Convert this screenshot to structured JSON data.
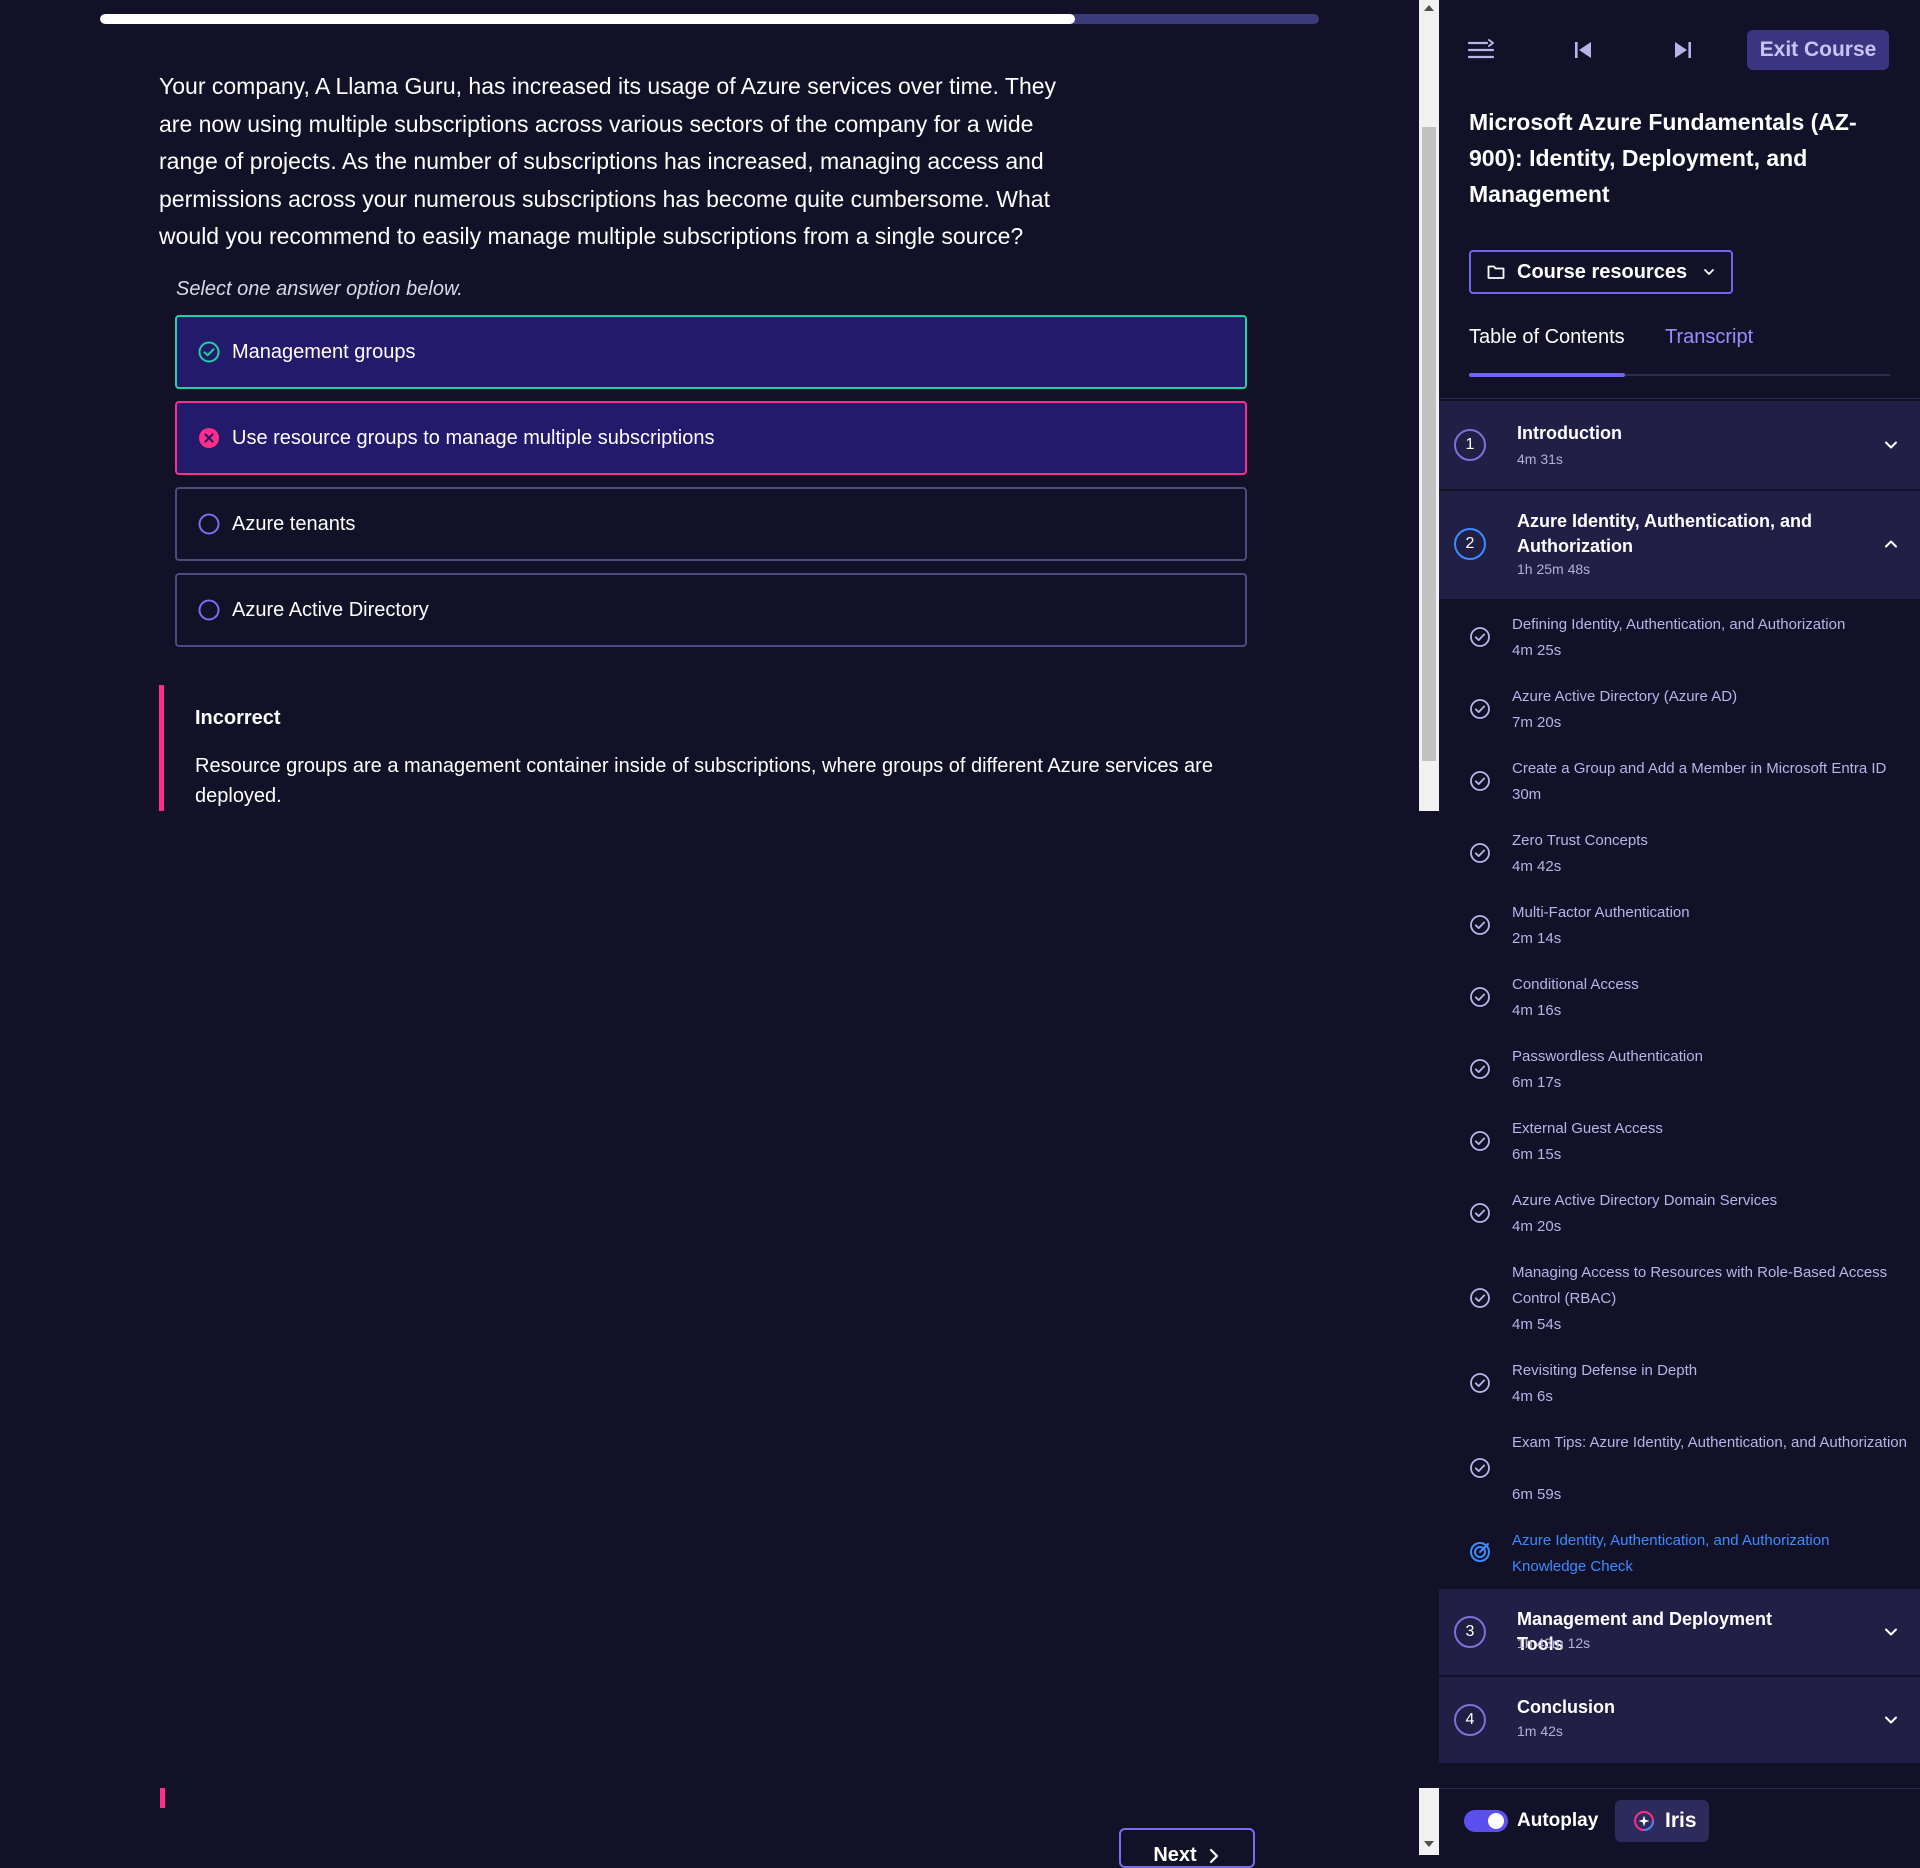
{
  "progress": {
    "fraction": 0.8
  },
  "question": {
    "text": "Your company, A Llama Guru, has increased its usage of Azure services over time. They are now using multiple subscriptions across various sectors of the company for a wide range of projects. As the number of subscriptions has increased, managing access and permissions across your numerous subscriptions has become quite cumbersome. What would you recommend to easily manage multiple subscriptions from a single source?",
    "instruction": "Select one answer option below.",
    "options": [
      {
        "label": "Management groups",
        "state": "correct",
        "icon": "check-circle-icon"
      },
      {
        "label": "Use resource groups to manage multiple subscriptions",
        "state": "incorrect",
        "icon": "x-circle-icon"
      },
      {
        "label": "Azure tenants",
        "state": "unselected",
        "icon": "radio-icon"
      },
      {
        "label": "Azure Active Directory",
        "state": "unselected",
        "icon": "radio-icon"
      }
    ]
  },
  "feedback": {
    "title": "Incorrect",
    "text": "Resource groups are a management container inside of subscriptions, where groups of different Azure services are deployed."
  },
  "next_label": "Next",
  "sidebar": {
    "exit_label": "Exit Course",
    "course_title": "Microsoft Azure Fundamentals (AZ-900): Identity, Deployment, and Management",
    "resources_label": "Course resources",
    "tabs": [
      {
        "label": "Table of Contents",
        "active": true
      },
      {
        "label": "Transcript",
        "active": false
      }
    ],
    "sections": [
      {
        "num": "1",
        "title": "Introduction",
        "duration": "4m 31s",
        "expanded": false
      },
      {
        "num": "2",
        "title": "Azure Identity, Authentication, and Authorization",
        "duration": "1h 25m 48s",
        "expanded": true
      },
      {
        "num": "3",
        "title": "Management and Deployment Tools",
        "duration": "1h 43m 12s",
        "expanded": false
      },
      {
        "num": "4",
        "title": "Conclusion",
        "duration": "1m 42s",
        "expanded": false
      }
    ],
    "lessons": [
      {
        "title": "Defining Identity, Authentication, and Authorization",
        "duration": "4m 25s"
      },
      {
        "title": "Azure Active Directory (Azure AD)",
        "duration": "7m 20s"
      },
      {
        "title": "Create a Group and Add a Member in Microsoft Entra ID",
        "duration": "30m"
      },
      {
        "title": "Zero Trust Concepts",
        "duration": "4m 42s"
      },
      {
        "title": "Multi-Factor Authentication",
        "duration": "2m 14s"
      },
      {
        "title": "Conditional Access",
        "duration": "4m 16s"
      },
      {
        "title": "Passwordless Authentication",
        "duration": "6m 17s"
      },
      {
        "title": "External Guest Access",
        "duration": "6m 15s"
      },
      {
        "title": "Azure Active Directory Domain Services",
        "duration": "4m 20s"
      },
      {
        "title": "Managing Access to Resources with Role-Based Access Control (RBAC)",
        "duration": "4m 54s"
      },
      {
        "title": "Revisiting Defense in Depth",
        "duration": "4m 6s"
      },
      {
        "title": "Exam Tips: Azure Identity, Authentication, and Authorization",
        "duration": "6m 59s"
      },
      {
        "title": "Azure Identity, Authentication, and Authorization Knowledge Check",
        "duration": "",
        "current": true
      }
    ],
    "autoplay_label": "Autoplay",
    "autoplay_on": true,
    "iris_label": "Iris"
  },
  "colors": {
    "background": "#131127",
    "correct": "#1fd1a3",
    "incorrect": "#ff2d8a",
    "accent": "#6e64f2",
    "current_lesson": "#3d8bff"
  }
}
